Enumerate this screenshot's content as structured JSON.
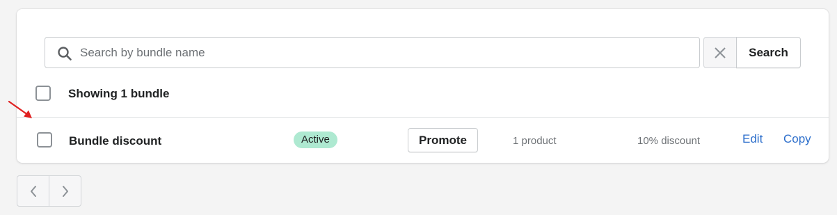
{
  "search": {
    "placeholder": "Search by bundle name",
    "value": "",
    "button_label": "Search"
  },
  "list": {
    "summary": "Showing 1 bundle",
    "rows": [
      {
        "name": "Bundle discount",
        "status": "Active",
        "promote_label": "Promote",
        "products": "1 product",
        "discount": "10% discount",
        "edit_label": "Edit",
        "copy_label": "Copy"
      }
    ]
  },
  "colors": {
    "accent": "#2c6ecb",
    "badge_success": "#aee9d1",
    "annotation_arrow": "#e02020"
  },
  "icons": [
    "search-icon",
    "close-icon",
    "chevron-left-icon",
    "chevron-right-icon",
    "annotation-arrow-icon"
  ]
}
